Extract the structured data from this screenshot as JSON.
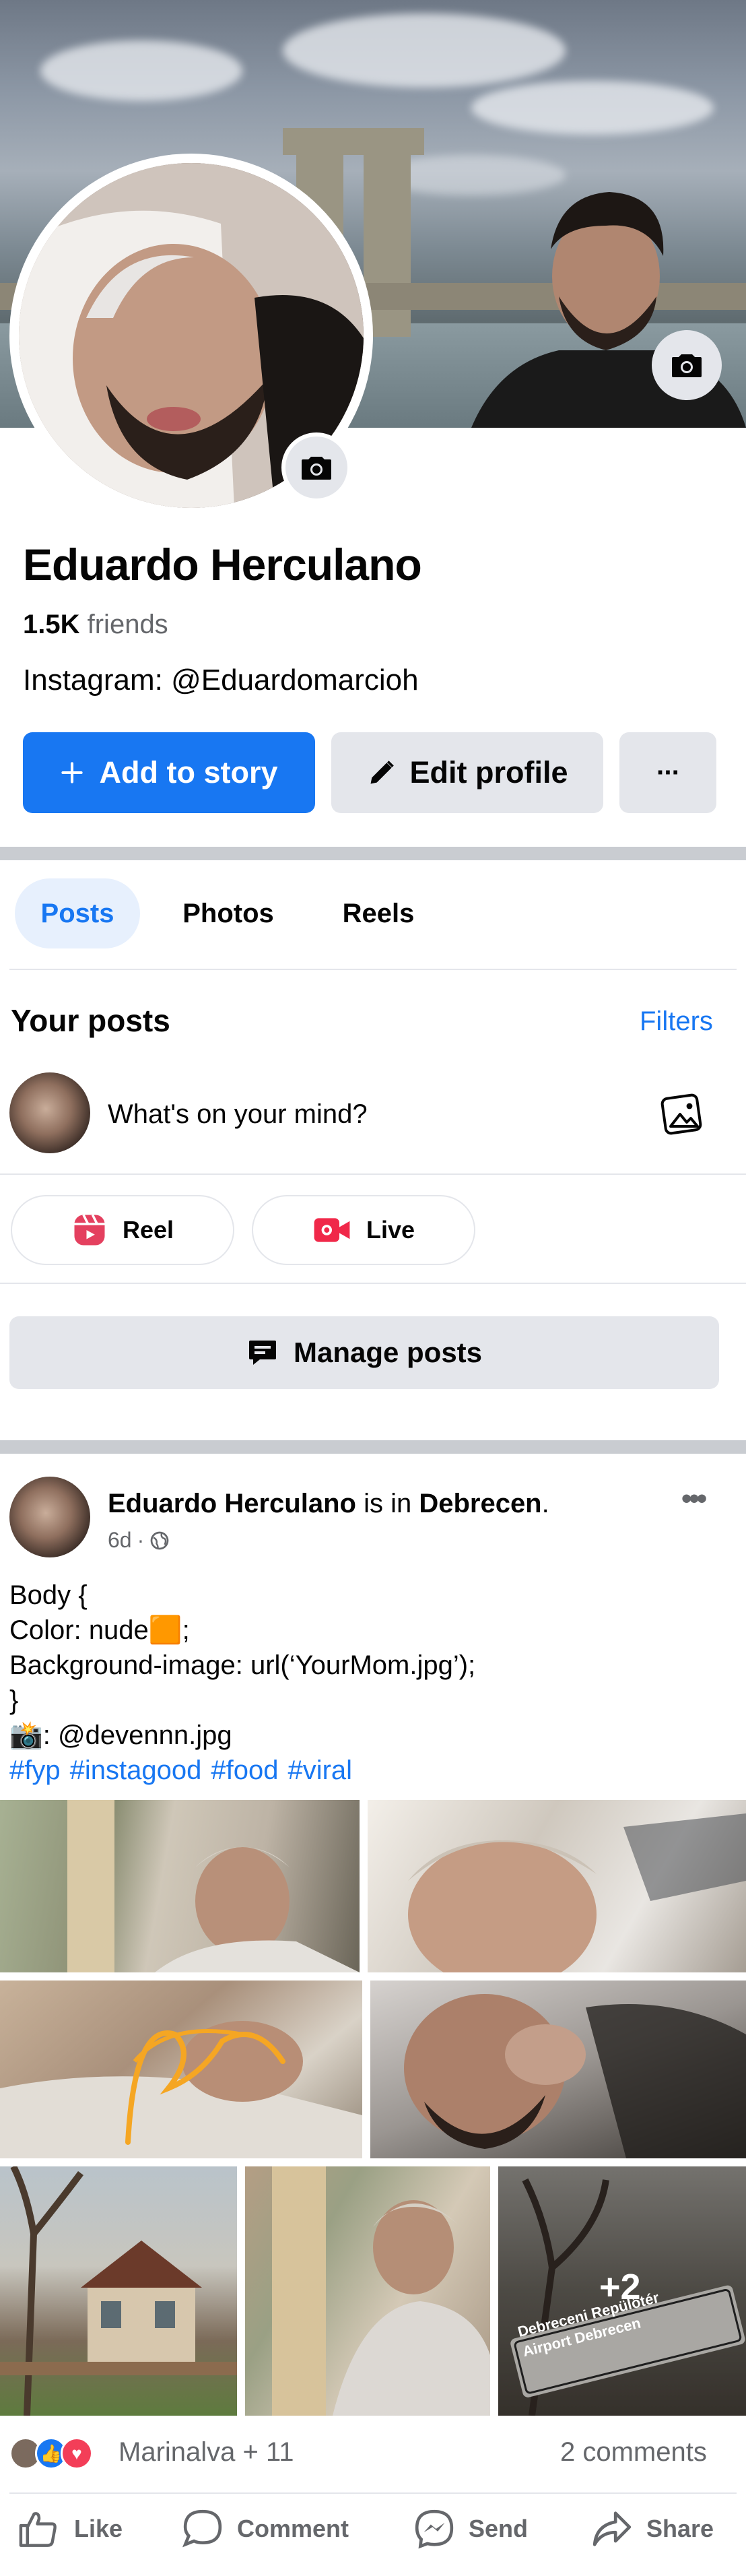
{
  "profile": {
    "name": "Eduardo Herculano",
    "friends_count": "1.5K",
    "friends_label": "friends",
    "bio": "Instagram: @Eduardomarcioh"
  },
  "actions": {
    "add_story_label": "Add to story",
    "edit_profile_label": "Edit profile",
    "more_label": "···"
  },
  "tabs": [
    {
      "label": "Posts",
      "active": true
    },
    {
      "label": "Photos",
      "active": false
    },
    {
      "label": "Reels",
      "active": false
    }
  ],
  "your_posts": {
    "title": "Your posts",
    "filters_label": "Filters",
    "composer_placeholder": "What's on your mind?",
    "reel_label": "Reel",
    "live_label": "Live",
    "manage_posts_label": "Manage posts"
  },
  "post": {
    "author": "Eduardo Herculano",
    "connector": " is in ",
    "place": "Debrecen",
    "time": "6d",
    "text_lines": [
      "Body {",
      "Color: nude🟧;",
      "Background-image: url(‘YourMom.jpg’);",
      "}",
      "📸: @devennn.jpg"
    ],
    "hashtags": [
      "#fyp",
      "#instagood",
      "#food",
      "#viral"
    ],
    "photo_sign_line1": "Debreceni Repülőtér",
    "photo_sign_line2": "Airport Debrecen",
    "more_photos": "+2",
    "reactions_text": "Marinalva + 11",
    "comments_text": "2 comments"
  },
  "post_actions": {
    "like": "Like",
    "comment": "Comment",
    "send": "Send",
    "share": "Share"
  },
  "colors": {
    "brand_blue": "#1877f2",
    "button_gray": "#e4e6eb",
    "secondary_text": "#65676b"
  }
}
